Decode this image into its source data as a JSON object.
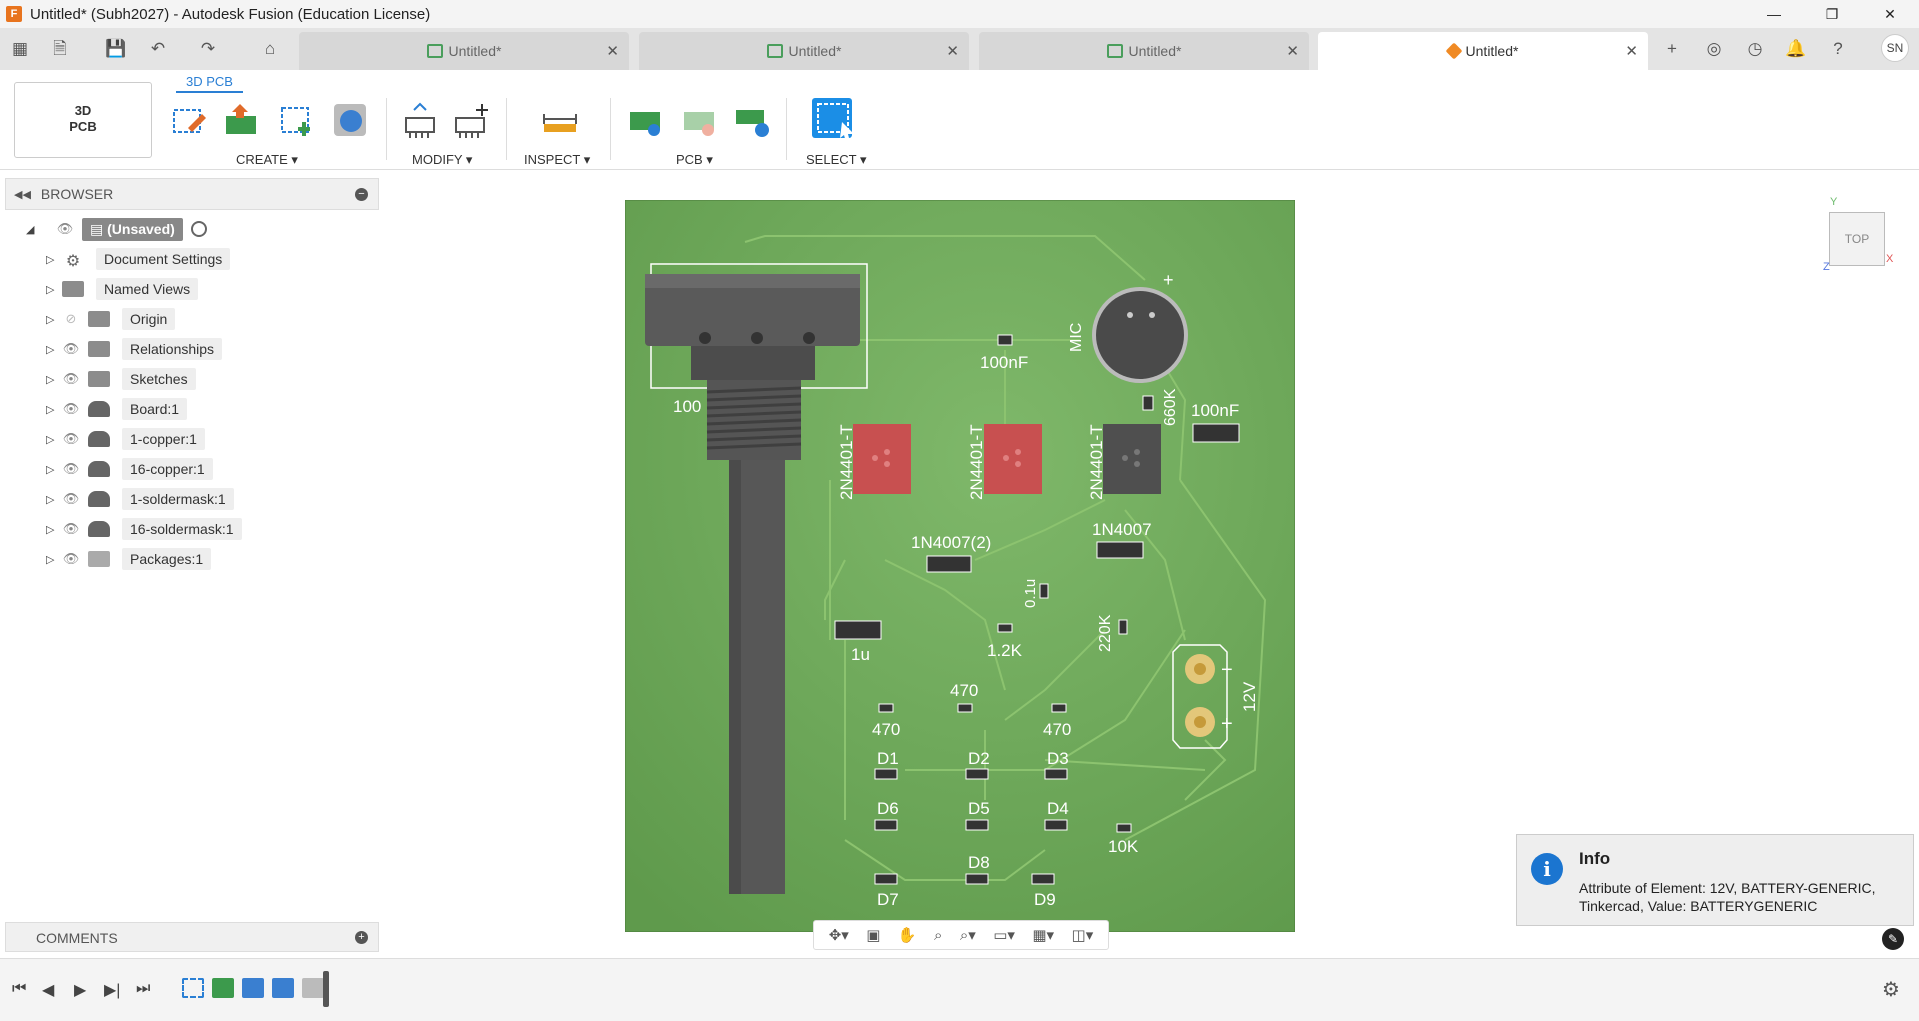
{
  "window": {
    "title": "Untitled* (Subh2027) - Autodesk Fusion (Education License)",
    "app_icon": "F",
    "controls": [
      "—",
      "❐",
      "✕"
    ]
  },
  "tabbar": {
    "tabs": [
      {
        "label": "Untitled*",
        "active": false
      },
      {
        "label": "Untitled*",
        "active": false
      },
      {
        "label": "Untitled*",
        "active": false
      },
      {
        "label": "Untitled*",
        "active": true
      }
    ],
    "avatar": "SN"
  },
  "toolbar": {
    "workspace_line1": "3D",
    "workspace_line2": "PCB",
    "workspace_tab": "3D PCB",
    "groups": {
      "create": "CREATE ▾",
      "modify": "MODIFY ▾",
      "inspect": "INSPECT ▾",
      "pcb": "PCB ▾",
      "select": "SELECT ▾"
    }
  },
  "browser": {
    "title": "BROWSER",
    "items": [
      {
        "label": "(Unsaved)",
        "icon": "document-icon"
      },
      {
        "label": "Document Settings",
        "icon": "gear-icon"
      },
      {
        "label": "Named Views",
        "icon": "folder-icon"
      },
      {
        "label": "Origin",
        "icon": "folder-icon"
      },
      {
        "label": "Relationships",
        "icon": "folder-icon"
      },
      {
        "label": "Sketches",
        "icon": "folder-icon"
      },
      {
        "label": "Board:1",
        "icon": "board-icon"
      },
      {
        "label": "1-copper:1",
        "icon": "board-icon"
      },
      {
        "label": "16-copper:1",
        "icon": "board-icon"
      },
      {
        "label": "1-soldermask:1",
        "icon": "board-icon"
      },
      {
        "label": "16-soldermask:1",
        "icon": "board-icon"
      },
      {
        "label": "Packages:1",
        "icon": "package-icon"
      }
    ]
  },
  "comments": {
    "title": "COMMENTS"
  },
  "pcb": {
    "board_color": "#6aa354",
    "labels": {
      "pot_value": "100",
      "c1": "100nF",
      "c2": "100nF",
      "mic": "MIC",
      "mic_plus": "+",
      "r660": "660K",
      "q1": "2N4401-T",
      "q2": "2N4401-T",
      "q3": "2N4401-T",
      "d_1n4007_2": "1N4007(2)",
      "d_1n4007": "1N4007",
      "c01u": "0.1u",
      "c1u": "1u",
      "r12k": "1.2K",
      "r220k": "220K",
      "r470a": "470",
      "r470b": "470",
      "r470c": "470",
      "batt": "12V",
      "batt_minus": "−",
      "batt_plus": "+",
      "D1": "D1",
      "D2": "D2",
      "D3": "D3",
      "D4": "D4",
      "D5": "D5",
      "D6": "D6",
      "D7": "D7",
      "D8": "D8",
      "D9": "D9",
      "r10k": "10K"
    }
  },
  "viewcube": {
    "face": "TOP",
    "x": "X",
    "y": "Y",
    "z": "Z"
  },
  "toast": {
    "title": "Info",
    "body": "Attribute of Element: 12V, BATTERY-GENERIC, Tinkercad, Value: BATTERYGENERIC"
  }
}
